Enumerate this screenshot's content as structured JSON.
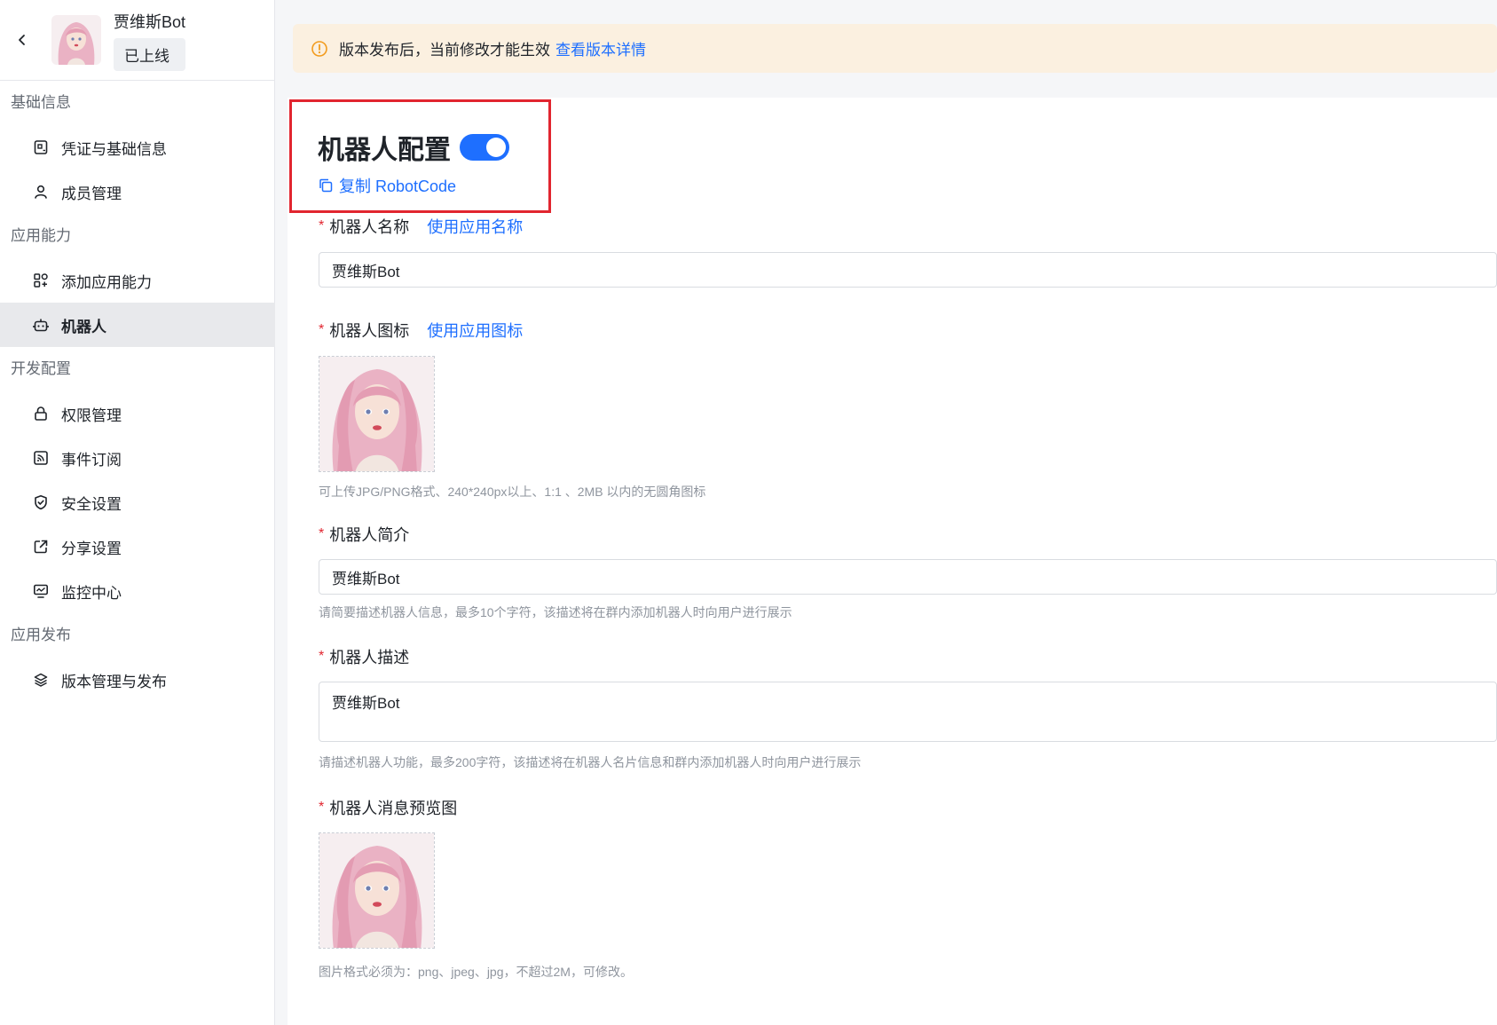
{
  "app": {
    "name": "贾维斯Bot",
    "status": "已上线"
  },
  "sidebar": {
    "groups": [
      {
        "title": "基础信息",
        "items": [
          {
            "label": "凭证与基础信息",
            "icon": "credential-icon"
          },
          {
            "label": "成员管理",
            "icon": "user-icon"
          }
        ]
      },
      {
        "title": "应用能力",
        "items": [
          {
            "label": "添加应用能力",
            "icon": "apps-add-icon"
          },
          {
            "label": "机器人",
            "icon": "robot-icon",
            "active": true
          }
        ]
      },
      {
        "title": "开发配置",
        "items": [
          {
            "label": "权限管理",
            "icon": "lock-icon"
          },
          {
            "label": "事件订阅",
            "icon": "rss-icon"
          },
          {
            "label": "安全设置",
            "icon": "shield-icon"
          },
          {
            "label": "分享设置",
            "icon": "share-icon"
          },
          {
            "label": "监控中心",
            "icon": "monitor-icon"
          }
        ]
      },
      {
        "title": "应用发布",
        "items": [
          {
            "label": "版本管理与发布",
            "icon": "layers-icon"
          }
        ]
      }
    ]
  },
  "notice": {
    "text": "版本发布后，当前修改才能生效",
    "link": "查看版本详情"
  },
  "robot_config": {
    "title": "机器人配置",
    "enabled": true,
    "copy_label": "复制 RobotCode"
  },
  "form": {
    "name": {
      "label": "机器人名称",
      "action": "使用应用名称",
      "value": "贾维斯Bot"
    },
    "icon": {
      "label": "机器人图标",
      "action": "使用应用图标",
      "hint": "可上传JPG/PNG格式、240*240px以上、1:1 、2MB 以内的无圆角图标"
    },
    "intro": {
      "label": "机器人简介",
      "value": "贾维斯Bot",
      "hint": "请简要描述机器人信息，最多10个字符，该描述将在群内添加机器人时向用户进行展示"
    },
    "description": {
      "label": "机器人描述",
      "value": "贾维斯Bot",
      "hint": "请描述机器人功能，最多200字符，该描述将在机器人名片信息和群内添加机器人时向用户进行展示"
    },
    "preview": {
      "label": "机器人消息预览图",
      "hint": "图片格式必须为：png、jpeg、jpg，不超过2M，可修改。"
    }
  },
  "colors": {
    "accent": "#1e6fff",
    "required": "#e1252f",
    "highlight_border": "#e1252f",
    "notice_bg": "#fbf0e0"
  }
}
